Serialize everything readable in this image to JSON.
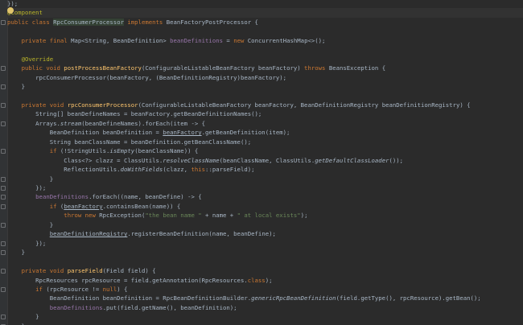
{
  "editor": {
    "lines": [
      {
        "t": [
          [
            "p",
            "});"
          ]
        ]
      },
      {
        "t": [
          [
            "ann",
            "@Component"
          ]
        ]
      },
      {
        "t": [
          [
            "kw",
            "public class "
          ],
          [
            "hl",
            "RpcConsumerProcessor"
          ],
          [
            "kw",
            " implements "
          ],
          [
            "p",
            "BeanFactoryPostProcessor {"
          ]
        ]
      },
      {
        "t": []
      },
      {
        "t": [
          [
            "p",
            "    "
          ],
          [
            "kw",
            "private final "
          ],
          [
            "p",
            "Map<String, BeanDefinition> "
          ],
          [
            "fld",
            "beanDefinitions"
          ],
          [
            "p",
            " = "
          ],
          [
            "kw",
            "new "
          ],
          [
            "p",
            "ConcurrentHashMap<>();"
          ]
        ]
      },
      {
        "t": []
      },
      {
        "t": [
          [
            "p",
            "    "
          ],
          [
            "ann",
            "@Override"
          ]
        ]
      },
      {
        "t": [
          [
            "p",
            "    "
          ],
          [
            "kw",
            "public void "
          ],
          [
            "fn",
            "postProcessBeanFactory"
          ],
          [
            "p",
            "(ConfigurableListableBeanFactory beanFactory) "
          ],
          [
            "kw",
            "throws "
          ],
          [
            "p",
            "BeansException {"
          ]
        ]
      },
      {
        "t": [
          [
            "p",
            "        rpcConsumerProcessor(beanFactory, (BeanDefinitionRegistry)beanFactory);"
          ]
        ]
      },
      {
        "t": [
          [
            "p",
            "    }"
          ]
        ]
      },
      {
        "t": []
      },
      {
        "t": [
          [
            "p",
            "    "
          ],
          [
            "kw",
            "private void "
          ],
          [
            "fn",
            "rpcConsumerProcessor"
          ],
          [
            "p",
            "(ConfigurableListableBeanFactory beanFactory, BeanDefinitionRegistry beanDefinitionRegistry) {"
          ]
        ]
      },
      {
        "t": [
          [
            "p",
            "        String[] beanDefineNames = beanFactory.getBeanDefinitionNames();"
          ]
        ]
      },
      {
        "t": [
          [
            "p",
            "        Arrays."
          ],
          [
            "ital",
            "stream"
          ],
          [
            "p",
            "(beanDefineNames).forEach(item -> {"
          ]
        ]
      },
      {
        "t": [
          [
            "p",
            "            BeanDefinition beanDefinition = "
          ],
          [
            "ul",
            "beanFactory"
          ],
          [
            "p",
            ".getBeanDefinition(item);"
          ]
        ]
      },
      {
        "t": [
          [
            "p",
            "            String beanClassName = beanDefinition.getBeanClassName();"
          ]
        ]
      },
      {
        "t": [
          [
            "p",
            "            "
          ],
          [
            "kw",
            "if "
          ],
          [
            "p",
            "(!StringUtils."
          ],
          [
            "ital",
            "isEmpty"
          ],
          [
            "p",
            "(beanClassName)) {"
          ]
        ]
      },
      {
        "t": [
          [
            "p",
            "                Class<?> clazz = ClassUtils."
          ],
          [
            "ital",
            "resolveClassName"
          ],
          [
            "p",
            "(beanClassName, ClassUtils."
          ],
          [
            "ital",
            "getDefaultClassLoader"
          ],
          [
            "p",
            "());"
          ]
        ]
      },
      {
        "t": [
          [
            "p",
            "                ReflectionUtils."
          ],
          [
            "ital",
            "doWithFields"
          ],
          [
            "p",
            "(clazz, "
          ],
          [
            "kw",
            "this"
          ],
          [
            "p",
            "::parseField);"
          ]
        ]
      },
      {
        "t": [
          [
            "p",
            "            }"
          ]
        ]
      },
      {
        "t": [
          [
            "p",
            "        });"
          ]
        ]
      },
      {
        "t": [
          [
            "p",
            "        "
          ],
          [
            "fld",
            "beanDefinitions"
          ],
          [
            "p",
            ".forEach((name, beanDefine) -> {"
          ]
        ]
      },
      {
        "t": [
          [
            "p",
            "            "
          ],
          [
            "kw",
            "if "
          ],
          [
            "p",
            "("
          ],
          [
            "ul",
            "beanFactory"
          ],
          [
            "p",
            ".containsBean(name)) {"
          ]
        ]
      },
      {
        "t": [
          [
            "p",
            "                "
          ],
          [
            "kw",
            "throw new "
          ],
          [
            "p",
            "RpcException("
          ],
          [
            "str",
            "\"the bean name \""
          ],
          [
            "p",
            " + name + "
          ],
          [
            "str",
            "\" at local exists\""
          ],
          [
            "p",
            ");"
          ]
        ]
      },
      {
        "t": [
          [
            "p",
            "            }"
          ]
        ]
      },
      {
        "t": [
          [
            "p",
            "            "
          ],
          [
            "ul",
            "beanDefinitionRegistry"
          ],
          [
            "p",
            ".registerBeanDefinition(name, beanDefine);"
          ]
        ]
      },
      {
        "t": [
          [
            "p",
            "        });"
          ]
        ]
      },
      {
        "t": [
          [
            "p",
            "    }"
          ]
        ]
      },
      {
        "t": []
      },
      {
        "t": [
          [
            "p",
            "    "
          ],
          [
            "kw",
            "private void "
          ],
          [
            "fn",
            "parseField"
          ],
          [
            "p",
            "(Field field) {"
          ]
        ]
      },
      {
        "t": [
          [
            "p",
            "        RpcResources rpcResource = field.getAnnotation(RpcResources."
          ],
          [
            "kw",
            "class"
          ],
          [
            "p",
            ");"
          ]
        ]
      },
      {
        "t": [
          [
            "p",
            "        "
          ],
          [
            "kw",
            "if "
          ],
          [
            "p",
            "(rpcResource != "
          ],
          [
            "kw",
            "null"
          ],
          [
            "p",
            ") {"
          ]
        ]
      },
      {
        "t": [
          [
            "p",
            "            BeanDefinition beanDefinition = RpcBeanDefinitionBuilder."
          ],
          [
            "ital",
            "genericRpcBeanDefinition"
          ],
          [
            "p",
            "(field.getType(), rpcResource).getBean();"
          ]
        ]
      },
      {
        "t": [
          [
            "p",
            "            "
          ],
          [
            "fld",
            "beanDefinitions"
          ],
          [
            "p",
            ".put(field.getName(), beanDefinition);"
          ]
        ]
      },
      {
        "t": [
          [
            "p",
            "        }"
          ]
        ]
      },
      {
        "t": [
          [
            "p",
            "    }"
          ]
        ]
      },
      {
        "t": [
          [
            "p",
            "}"
          ]
        ]
      }
    ]
  }
}
